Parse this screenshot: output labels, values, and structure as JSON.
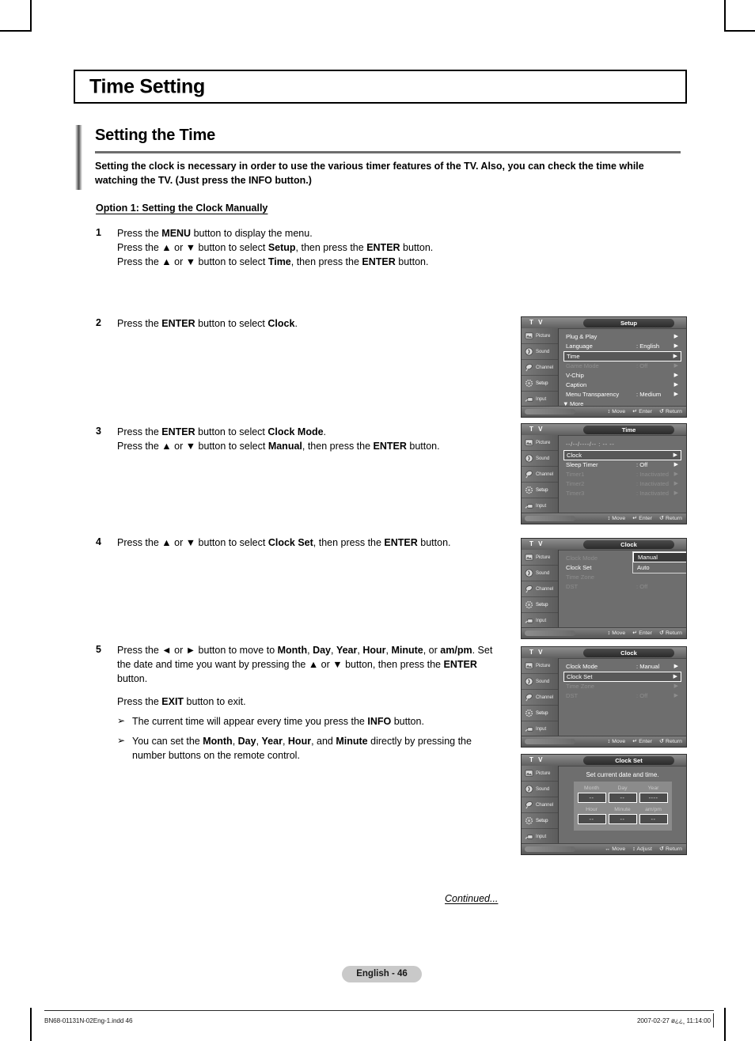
{
  "document": {
    "title": "Time Setting",
    "section_title": "Setting the Time",
    "section_desc": "Setting the clock is necessary in order to use the various timer features of the TV. Also, you can check the time while watching the TV. (Just press the INFO button.)",
    "option_heading": "Option 1: Setting the Clock Manually",
    "continued": "Continued...",
    "page_label": "English - 46",
    "footer_left": "BN68-01131N-02Eng-1.indd   46",
    "footer_right": "2007-02-27   ø¿¿¸ 11:14:00"
  },
  "steps": [
    {
      "num": "1",
      "lines": [
        "Press the <b>MENU</b> button to display the menu.",
        "Press the ▲ or ▼ button to select <b>Setup</b>, then press the <b>ENTER</b> button.",
        "Press the ▲ or ▼ button to select <b>Time</b>, then press the <b>ENTER</b> button."
      ]
    },
    {
      "num": "2",
      "lines": [
        "Press the <b>ENTER</b> button to select <b>Clock</b>."
      ]
    },
    {
      "num": "3",
      "lines": [
        "Press the <b>ENTER</b> button to select <b>Clock Mode</b>.",
        "Press the ▲ or ▼ button to select <b>Manual</b>, then press the <b>ENTER</b> button."
      ]
    },
    {
      "num": "4",
      "lines": [
        "Press the ▲ or ▼ button to select <b>Clock Set</b>, then press the <b>ENTER</b> button."
      ]
    },
    {
      "num": "5",
      "lines": [
        "Press the ◄ or ► button to move to <b>Month</b>, <b>Day</b>, <b>Year</b>, <b>Hour</b>, <b>Minute</b>, or <b>am/pm</b>. Set the date and time you want by pressing the ▲ or ▼ button, then press the <b>ENTER</b> button."
      ],
      "extra_paragraph": "Press the <b>EXIT</b> button to exit.",
      "notes": [
        "The current time will appear every time you press the <b>INFO</b> button.",
        "You can set the <b>Month</b>, <b>Day</b>, <b>Year</b>, <b>Hour</b>, and <b>Minute</b> directly by pressing the number buttons on the remote control."
      ]
    }
  ],
  "osd_common": {
    "brand": "T V",
    "sidebar": [
      {
        "label": "Picture",
        "icon": "picture-icon"
      },
      {
        "label": "Sound",
        "icon": "sound-icon"
      },
      {
        "label": "Channel",
        "icon": "channel-icon"
      },
      {
        "label": "Setup",
        "icon": "setup-icon"
      },
      {
        "label": "Input",
        "icon": "input-icon"
      }
    ],
    "hints_move_enter_return": {
      "move": "Move",
      "enter": "Enter",
      "return": "Return"
    },
    "hints_move_adjust_return": {
      "move": "Move",
      "adjust": "Adjust",
      "return": "Return"
    }
  },
  "osd_panels": [
    {
      "id": "setup",
      "title": "Setup",
      "active_sidebar": "Setup",
      "rows": [
        {
          "label": "Plug & Play",
          "value": "",
          "arrow": true,
          "state": "normal"
        },
        {
          "label": "Language",
          "value": ": English",
          "arrow": true,
          "state": "normal"
        },
        {
          "label": "Time",
          "value": "",
          "arrow": true,
          "state": "selected"
        },
        {
          "label": "Game Mode",
          "value": ": Off",
          "arrow": true,
          "state": "dim"
        },
        {
          "label": "V-Chip",
          "value": "",
          "arrow": true,
          "state": "normal"
        },
        {
          "label": "Caption",
          "value": "",
          "arrow": true,
          "state": "normal"
        },
        {
          "label": "Menu Transparency",
          "value": ": Medium",
          "arrow": true,
          "state": "normal"
        },
        {
          "label": "More",
          "value": "",
          "arrow": false,
          "state": "more"
        }
      ]
    },
    {
      "id": "time",
      "title": "Time",
      "active_sidebar": "Setup",
      "clock_line": "--/--/----/-- : -- --",
      "rows": [
        {
          "label": "Clock",
          "value": "",
          "arrow": true,
          "state": "selected"
        },
        {
          "label": "Sleep Timer",
          "value": ": Off",
          "arrow": true,
          "state": "normal"
        },
        {
          "label": "Timer1",
          "value": ": Inactivated",
          "arrow": true,
          "state": "dim"
        },
        {
          "label": "Timer2",
          "value": ": Inactivated",
          "arrow": true,
          "state": "dim"
        },
        {
          "label": "Timer3",
          "value": ": Inactivated",
          "arrow": true,
          "state": "dim"
        }
      ]
    },
    {
      "id": "clock-mode-dropdown",
      "title": "Clock",
      "active_sidebar": "Setup",
      "rows": [
        {
          "label": "Clock Mode",
          "value": ":",
          "arrow": false,
          "state": "dim"
        },
        {
          "label": "Clock Set",
          "value": "",
          "arrow": false,
          "state": "normal"
        },
        {
          "label": "Time Zone",
          "value": "",
          "arrow": false,
          "state": "dim"
        },
        {
          "label": "DST",
          "value": ": Off",
          "arrow": false,
          "state": "dim"
        }
      ],
      "dropdown": {
        "options": [
          "Manual",
          "Auto"
        ],
        "selected": "Manual"
      }
    },
    {
      "id": "clock-set-select",
      "title": "Clock",
      "active_sidebar": "Setup",
      "rows": [
        {
          "label": "Clock Mode",
          "value": ": Manual",
          "arrow": true,
          "state": "normal"
        },
        {
          "label": "Clock Set",
          "value": "",
          "arrow": true,
          "state": "selected"
        },
        {
          "label": "Time Zone",
          "value": "",
          "arrow": true,
          "state": "dim"
        },
        {
          "label": "DST",
          "value": ": Off",
          "arrow": true,
          "state": "dim"
        }
      ]
    },
    {
      "id": "clock-set",
      "title": "Clock Set",
      "active_sidebar": "Setup",
      "prompt": "Set current date and time.",
      "fields": [
        {
          "label": "Month",
          "value": "--"
        },
        {
          "label": "Day",
          "value": "--"
        },
        {
          "label": "Year",
          "value": "----"
        },
        {
          "label": "Hour",
          "value": "--"
        },
        {
          "label": "Minute",
          "value": "--"
        },
        {
          "label": "am/pm",
          "value": "--"
        }
      ]
    }
  ]
}
